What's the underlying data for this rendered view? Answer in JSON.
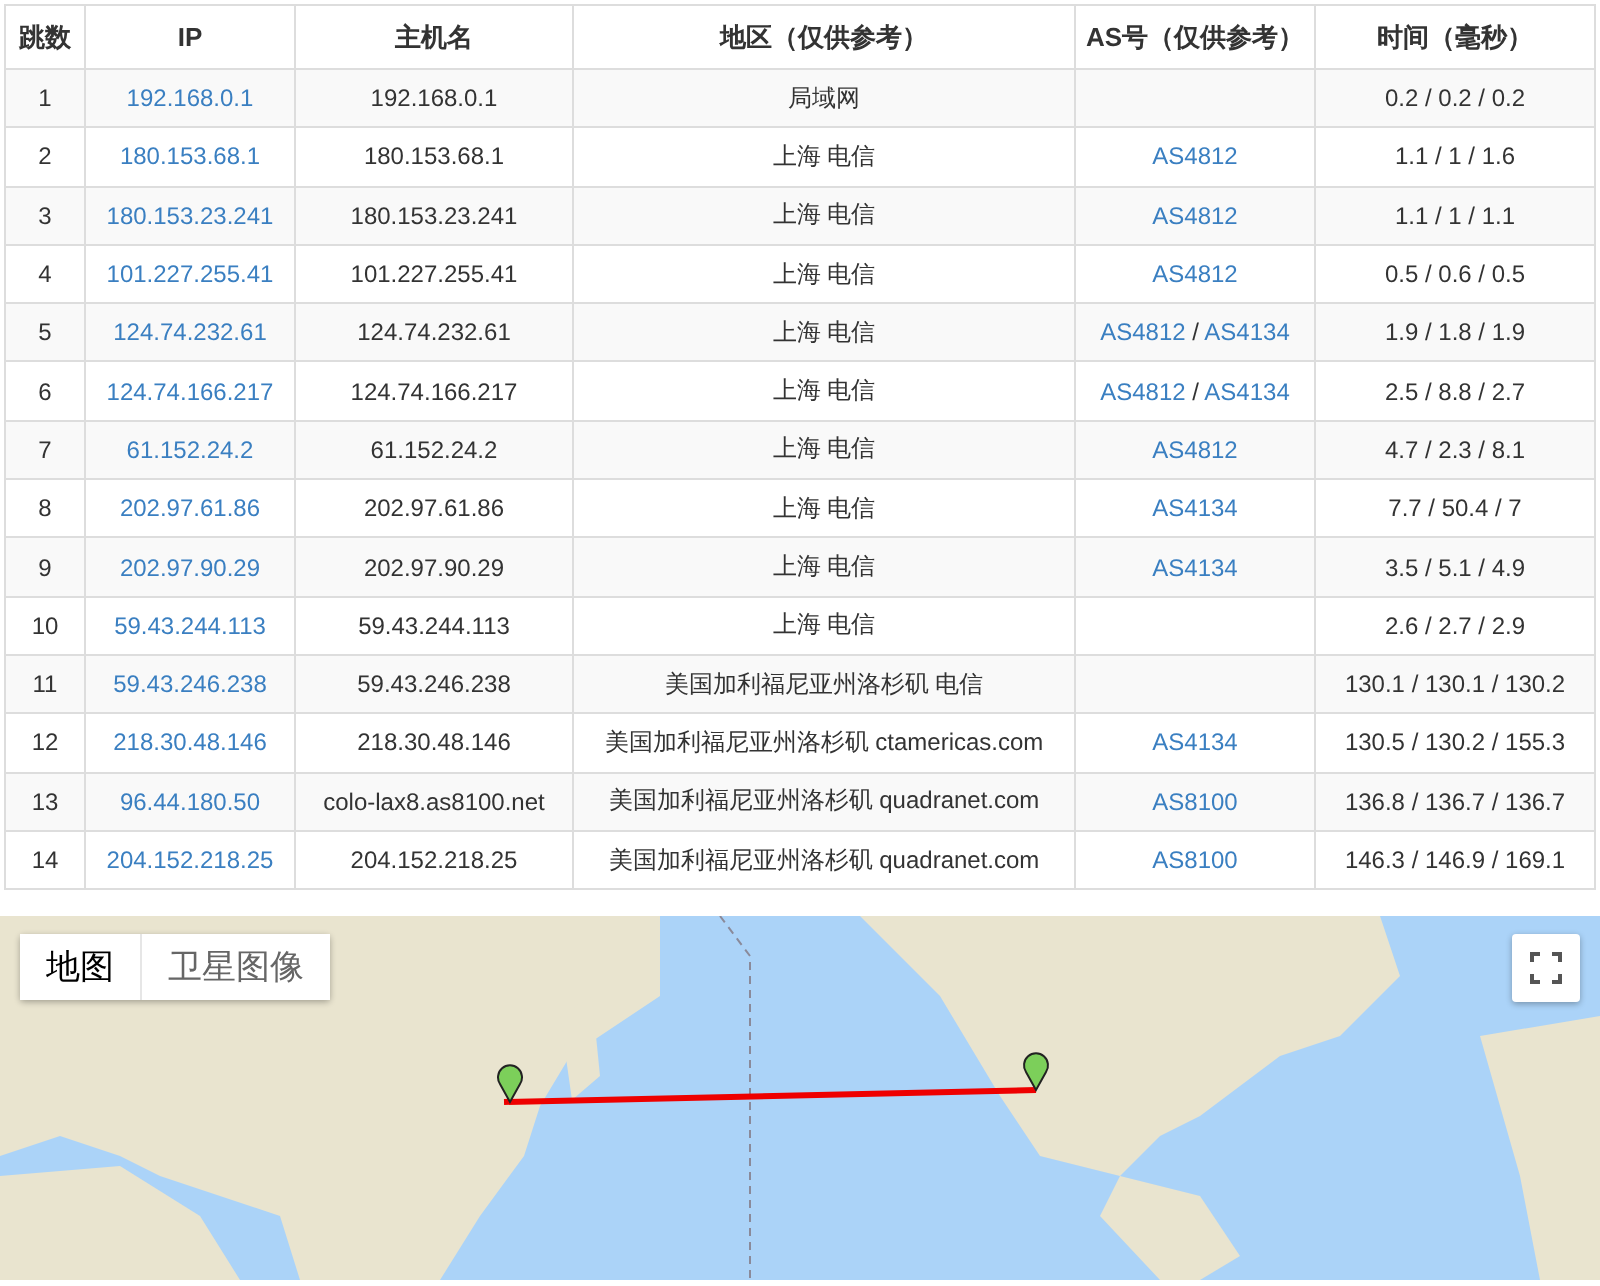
{
  "table": {
    "columns": [
      "跳数",
      "IP",
      "主机名",
      "地区（仅供参考）",
      "AS号（仅供参考）",
      "时间（毫秒）"
    ],
    "rows": [
      {
        "hop": "1",
        "ip": "192.168.0.1",
        "host": "192.168.0.1",
        "region": "局域网",
        "as": [],
        "time": "0.2 / 0.2 / 0.2"
      },
      {
        "hop": "2",
        "ip": "180.153.68.1",
        "host": "180.153.68.1",
        "region": "上海 电信",
        "as": [
          "AS4812"
        ],
        "time": "1.1 / 1 / 1.6"
      },
      {
        "hop": "3",
        "ip": "180.153.23.241",
        "host": "180.153.23.241",
        "region": "上海 电信",
        "as": [
          "AS4812"
        ],
        "time": "1.1 / 1 / 1.1"
      },
      {
        "hop": "4",
        "ip": "101.227.255.41",
        "host": "101.227.255.41",
        "region": "上海 电信",
        "as": [
          "AS4812"
        ],
        "time": "0.5 / 0.6 / 0.5"
      },
      {
        "hop": "5",
        "ip": "124.74.232.61",
        "host": "124.74.232.61",
        "region": "上海 电信",
        "as": [
          "AS4812",
          {
            "kind": "separator",
            "text": "/"
          },
          "AS4134"
        ],
        "time": "1.9 / 1.8 / 1.9"
      },
      {
        "hop": "6",
        "ip": "124.74.166.217",
        "host": "124.74.166.217",
        "region": "上海 电信",
        "as": [
          "AS4812",
          {
            "kind": "separator",
            "text": "/"
          },
          "AS4134"
        ],
        "time": "2.5 / 8.8 / 2.7"
      },
      {
        "hop": "7",
        "ip": "61.152.24.2",
        "host": "61.152.24.2",
        "region": "上海 电信",
        "as": [
          "AS4812"
        ],
        "time": "4.7 / 2.3 / 8.1"
      },
      {
        "hop": "8",
        "ip": "202.97.61.86",
        "host": "202.97.61.86",
        "region": "上海 电信",
        "as": [
          "AS4134"
        ],
        "time": "7.7 / 50.4 / 7"
      },
      {
        "hop": "9",
        "ip": "202.97.90.29",
        "host": "202.97.90.29",
        "region": "上海 电信",
        "as": [
          "AS4134"
        ],
        "time": "3.5 / 5.1 / 4.9"
      },
      {
        "hop": "10",
        "ip": "59.43.244.113",
        "host": "59.43.244.113",
        "region": "上海 电信",
        "as": [],
        "time": "2.6 / 2.7 / 2.9"
      },
      {
        "hop": "11",
        "ip": "59.43.246.238",
        "host": "59.43.246.238",
        "region": "美国加利福尼亚州洛杉矶 电信",
        "as": [],
        "time": "130.1 / 130.1 / 130.2"
      },
      {
        "hop": "12",
        "ip": "218.30.48.146",
        "host": "218.30.48.146",
        "region": "美国加利福尼亚州洛杉矶 ctamericas.com",
        "as": [
          "AS4134"
        ],
        "time": "130.5 / 130.2 / 155.3"
      },
      {
        "hop": "13",
        "ip": "96.44.180.50",
        "host": "colo-lax8.as8100.net",
        "region": "美国加利福尼亚州洛杉矶 quadranet.com",
        "as": [
          "AS8100"
        ],
        "time": "136.8 / 136.7 / 136.7"
      },
      {
        "hop": "14",
        "ip": "204.152.218.25",
        "host": "204.152.218.25",
        "region": "美国加利福尼亚州洛杉矶 quadranet.com",
        "as": [
          "AS8100"
        ],
        "time": "146.3 / 146.9 / 169.1"
      }
    ]
  },
  "map": {
    "map_types": [
      {
        "label": "地图",
        "selected": true
      },
      {
        "label": "卫星图像",
        "selected": false
      }
    ]
  }
}
